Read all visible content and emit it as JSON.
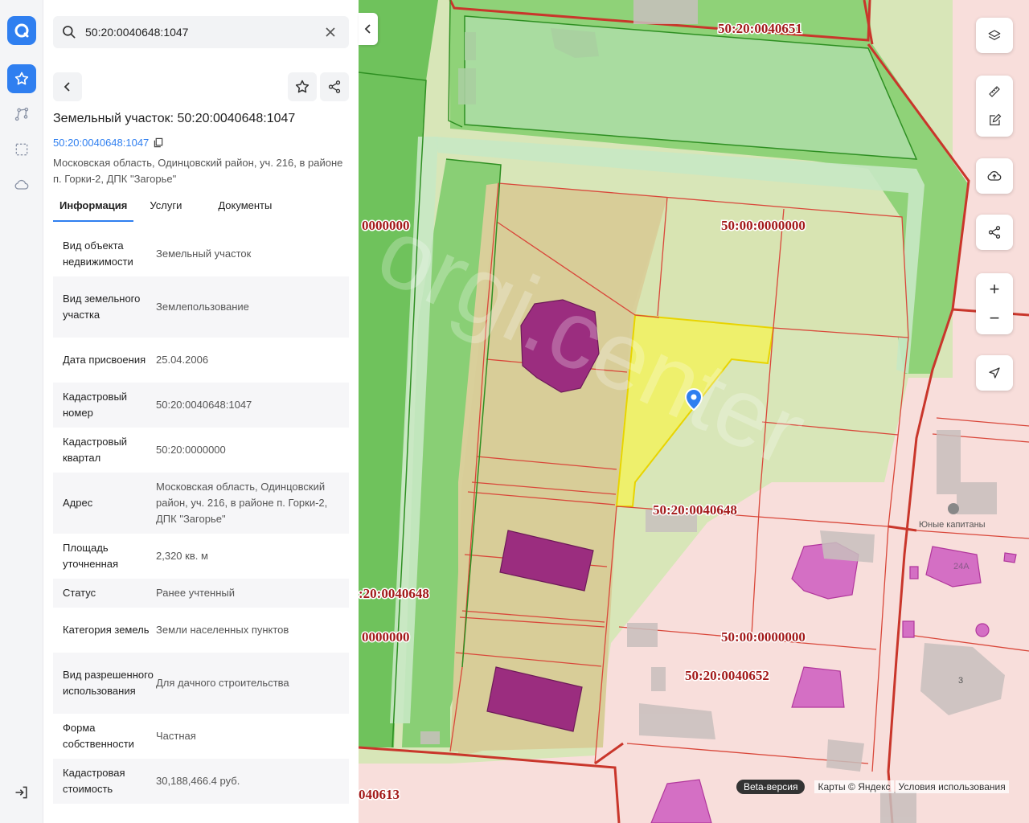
{
  "rail": {
    "items": [
      {
        "name": "favorites",
        "icon": "star-icon",
        "active": true
      },
      {
        "name": "route",
        "icon": "route-icon",
        "active": false
      },
      {
        "name": "select-area",
        "icon": "selection-icon",
        "active": false
      },
      {
        "name": "cloud",
        "icon": "cloud-icon",
        "active": false
      }
    ],
    "logout_icon": "logout-icon"
  },
  "search": {
    "value": "50:20:0040648:1047",
    "placeholder": ""
  },
  "object": {
    "title": "Земельный участок: 50:20:0040648:1047",
    "cad_number": "50:20:0040648:1047",
    "address": "Московская область, Одинцовский район, уч. 216, в районе п. Горки-2, ДПК \"Загорье\""
  },
  "tabs": [
    {
      "label": "Информация",
      "active": true
    },
    {
      "label": "Услуги",
      "active": false
    },
    {
      "label": "Документы",
      "active": false
    }
  ],
  "info_rows": [
    {
      "key": "Вид объекта недвижимости",
      "value": "Земельный участок"
    },
    {
      "key": "Вид земельного участка",
      "value": "Землепользование"
    },
    {
      "key": "Дата присвоения",
      "value": "25.04.2006"
    },
    {
      "key": "Кадастровый номер",
      "value": "50:20:0040648:1047"
    },
    {
      "key": "Кадастровый квартал",
      "value": "50:20:0000000"
    },
    {
      "key": "Адрес",
      "value": "Московская область, Одинцовский район, уч. 216, в районе п. Горки-2, ДПК \"Загорье\""
    },
    {
      "key": "Площадь уточненная",
      "value": "2,320 кв. м"
    },
    {
      "key": "Статус",
      "value": "Ранее учтенный"
    },
    {
      "key": "Категория земель",
      "value": "Земли населенных пунктов"
    },
    {
      "key": "Вид разрешенного использования",
      "value": "Для дачного строительства"
    },
    {
      "key": "Форма собственности",
      "value": "Частная"
    },
    {
      "key": "Кадастровая стоимость",
      "value": "30,188,466.4 руб."
    }
  ],
  "map": {
    "labels": {
      "q0651": "50:20:0040651",
      "q0000_a": "50:00:0000000",
      "q0000_b": "50:00:0000000",
      "left_0000_a": "0000000",
      "left_0000_b": "0000000",
      "left_0648": ":20:0040648",
      "q0648": "50:20:0040648",
      "q0652": "50:20:0040652",
      "q0613": "040613",
      "poi": "Юные капитаны",
      "house_24a": "24А",
      "house_3": "3",
      "watermark": "orgi.center"
    },
    "colors": {
      "quarter_border": "#d9473a",
      "selected_fill": "#f0f060",
      "building": "#9b2d7f",
      "green": "#86cf72"
    },
    "attribution": {
      "beta": "Beta-версия",
      "copyright": "Карты © Яндекс",
      "terms": "Условия использования"
    }
  },
  "controls": {
    "layers": "layers-icon",
    "ruler": "ruler-icon",
    "edit": "edit-icon",
    "upload": "upload-icon",
    "share": "share-icon",
    "zoom_in": "+",
    "zoom_out": "−",
    "locate": "locate-icon"
  }
}
